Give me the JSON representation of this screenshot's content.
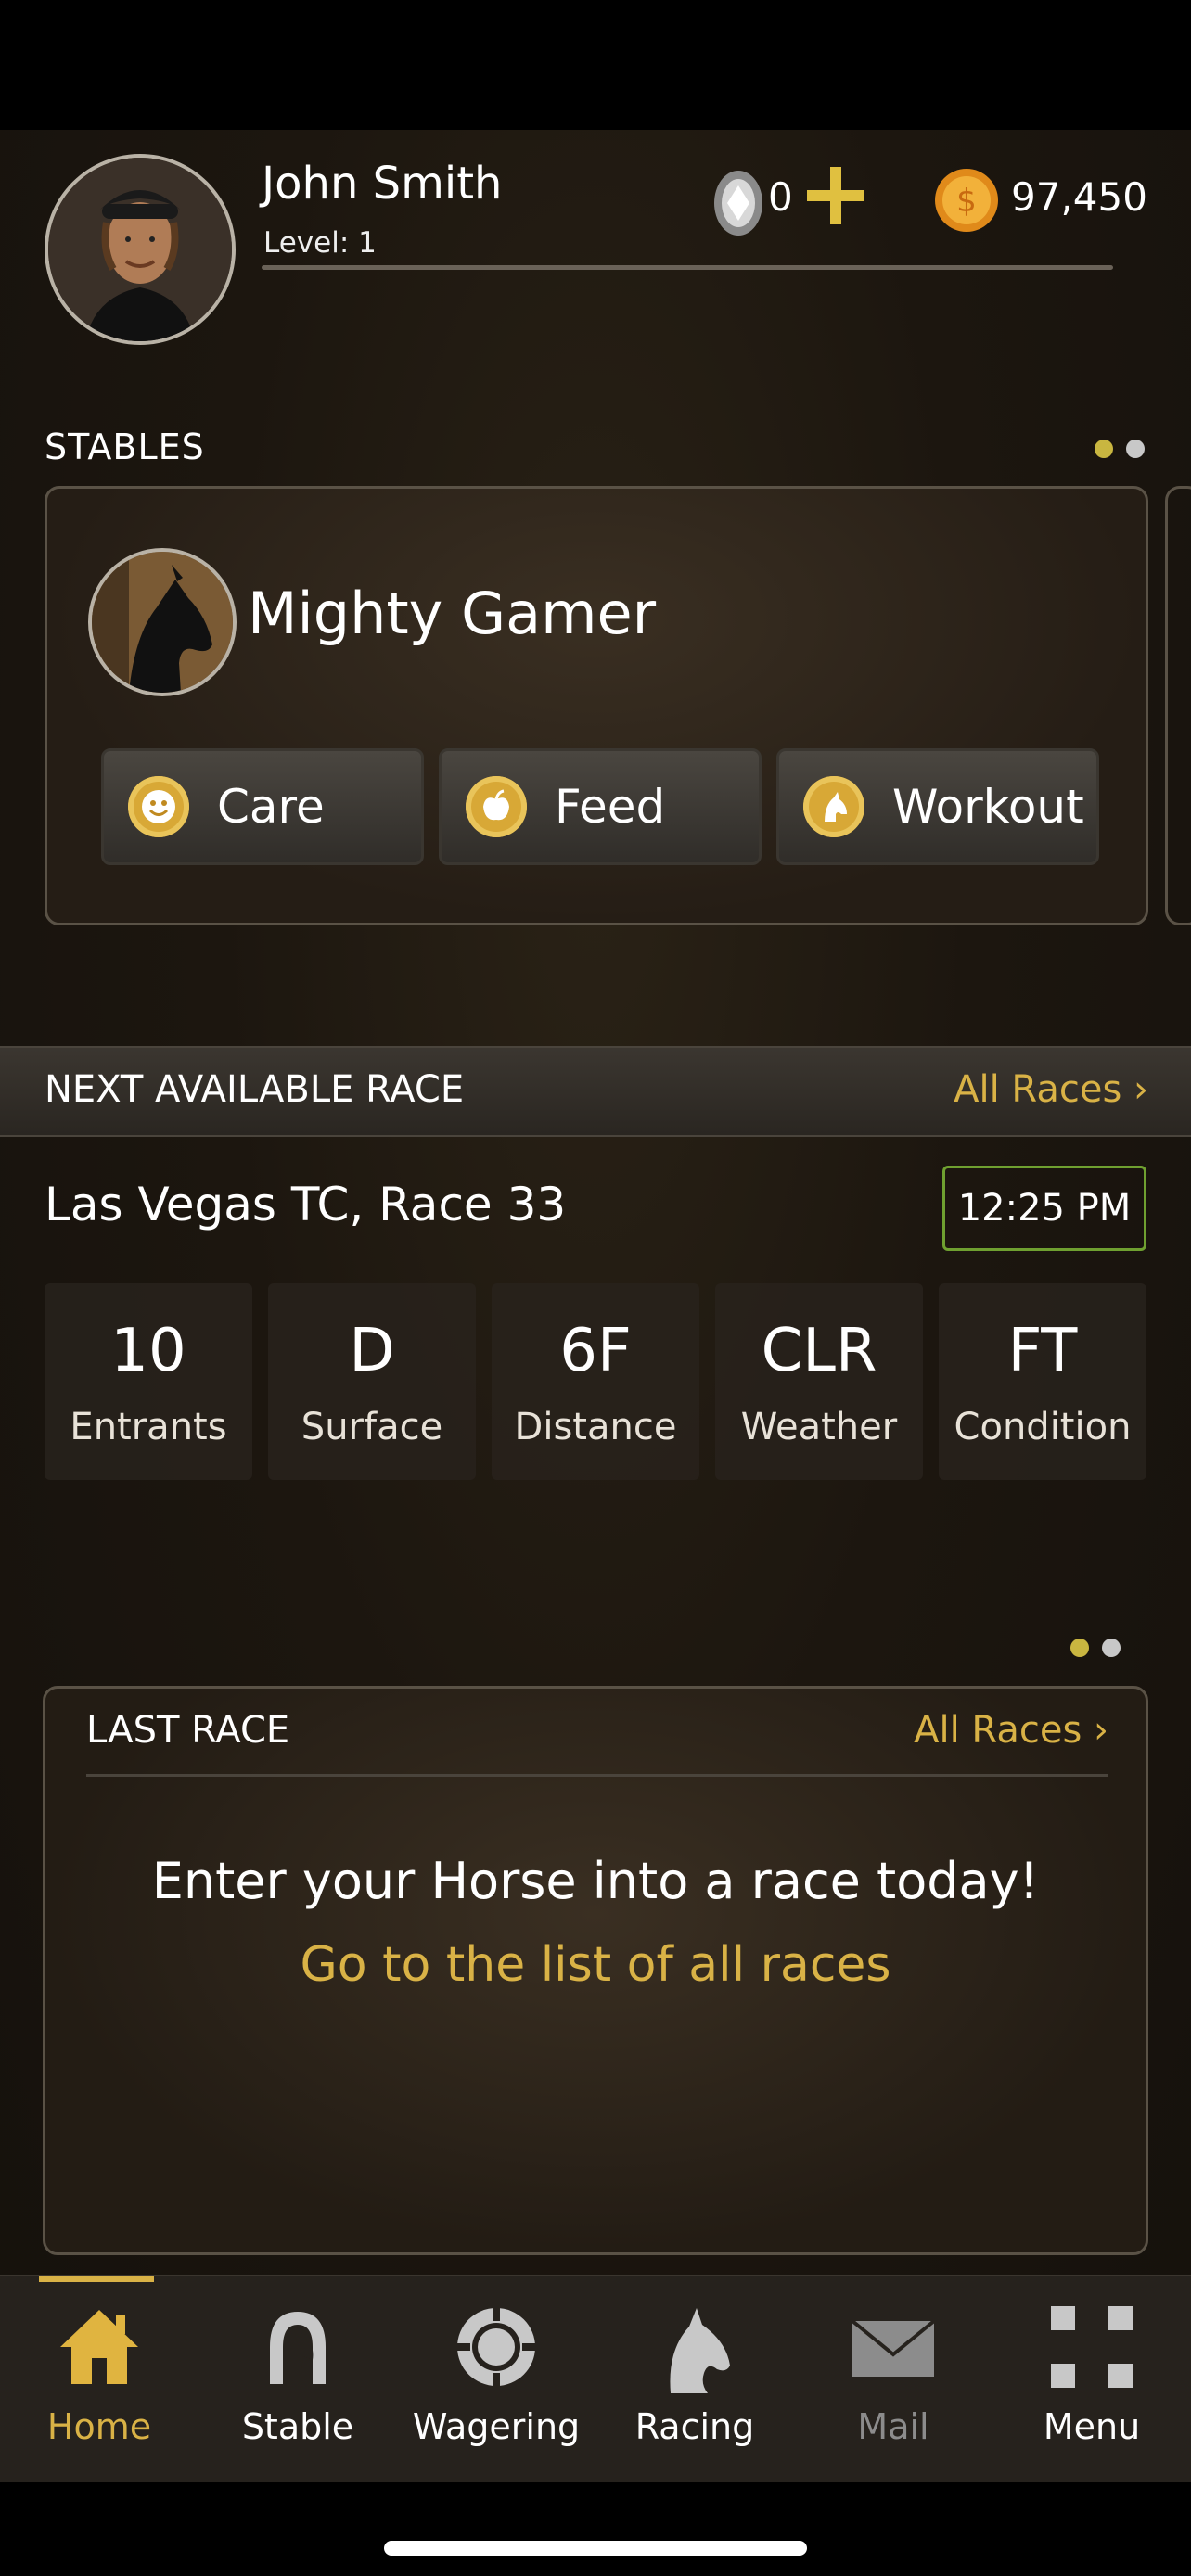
{
  "user": {
    "name": "John Smith",
    "level": "Level: 1",
    "diamonds": "0",
    "coins": "97,450"
  },
  "stables": {
    "label": "STABLES",
    "horse_name": "Mighty Gamer",
    "actions": [
      {
        "label": "Care",
        "icon": "smiley-icon"
      },
      {
        "label": "Feed",
        "icon": "apple-icon"
      },
      {
        "label": "Workout",
        "icon": "horse-head-icon"
      }
    ]
  },
  "next_race": {
    "label": "NEXT AVAILABLE RACE",
    "all_races": "All Races",
    "name": "Las Vegas TC, Race 33",
    "time": "12:25 PM",
    "stats": [
      {
        "value": "10",
        "key": "Entrants"
      },
      {
        "value": "D",
        "key": "Surface"
      },
      {
        "value": "6F",
        "key": "Distance"
      },
      {
        "value": "CLR",
        "key": "Weather"
      },
      {
        "value": "FT",
        "key": "Condition"
      }
    ]
  },
  "last_race": {
    "label": "LAST RACE",
    "all_races": "All Races",
    "message": "Enter your Horse into a race today!",
    "cta": "Go to the list of all races"
  },
  "tabs": [
    {
      "label": "Home",
      "active": true
    },
    {
      "label": "Stable"
    },
    {
      "label": "Wagering"
    },
    {
      "label": "Racing"
    },
    {
      "label": "Mail"
    },
    {
      "label": "Menu"
    }
  ],
  "colors": {
    "accent": "#d9b246",
    "time_border": "#6fa030"
  }
}
